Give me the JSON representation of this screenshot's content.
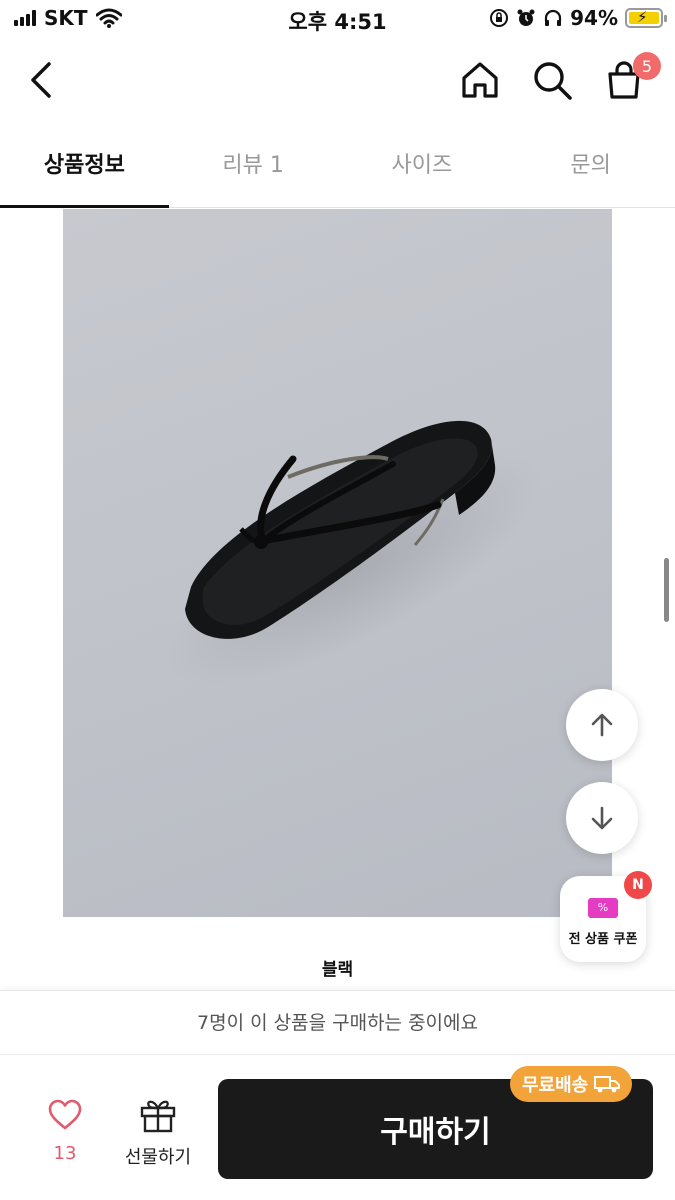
{
  "status_bar": {
    "carrier": "SKT",
    "time": "오후 4:51",
    "battery_percent": "94%"
  },
  "header": {
    "icons": [
      "back-icon",
      "home-icon",
      "search-icon",
      "cart-icon"
    ],
    "cart_count": "5"
  },
  "tabs": [
    {
      "label": "상품정보",
      "active": true
    },
    {
      "label": "리뷰 1",
      "active": false
    },
    {
      "label": "사이즈",
      "active": false
    },
    {
      "label": "문의",
      "active": false
    }
  ],
  "product": {
    "option_label": "블랙"
  },
  "floating": {
    "coupon_badge": "N",
    "coupon_label": "전 상품 쿠폰"
  },
  "footer": {
    "buyers_text": "7명이 이 상품을 구매하는 중이에요",
    "like_count": "13",
    "gift_label": "선물하기",
    "buy_label": "구매하기",
    "free_shipping_label": "무료배송"
  },
  "colors": {
    "accent_red": "#f26b6b",
    "like_pink": "#e25b6d",
    "free_shipping": "#f2a33a",
    "coupon_pink": "#e63cc4",
    "buy_button": "#1a1a1a"
  }
}
